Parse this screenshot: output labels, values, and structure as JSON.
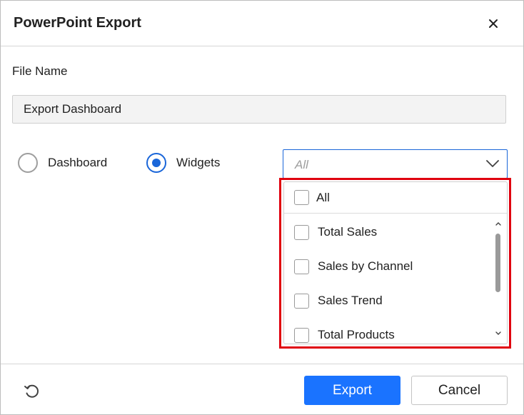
{
  "dialog": {
    "title": "PowerPoint Export"
  },
  "file": {
    "label": "File Name",
    "value": "Export Dashboard"
  },
  "export_type": {
    "options": [
      {
        "label": "Dashboard",
        "selected": false
      },
      {
        "label": "Widgets",
        "selected": true
      }
    ]
  },
  "widget_select": {
    "placeholder": "All",
    "select_all_label": "All",
    "items": [
      {
        "label": "Total Sales",
        "checked": false
      },
      {
        "label": "Sales by Channel",
        "checked": false
      },
      {
        "label": "Sales Trend",
        "checked": false
      },
      {
        "label": "Total Products",
        "checked": false
      }
    ]
  },
  "footer": {
    "export_label": "Export",
    "cancel_label": "Cancel"
  },
  "colors": {
    "accent": "#1a66d9",
    "primary_button": "#1a73ff",
    "highlight": "#e0000f"
  },
  "icons": {
    "close": "close-icon",
    "chevron": "chevron-down-icon",
    "reset": "reset-icon"
  }
}
